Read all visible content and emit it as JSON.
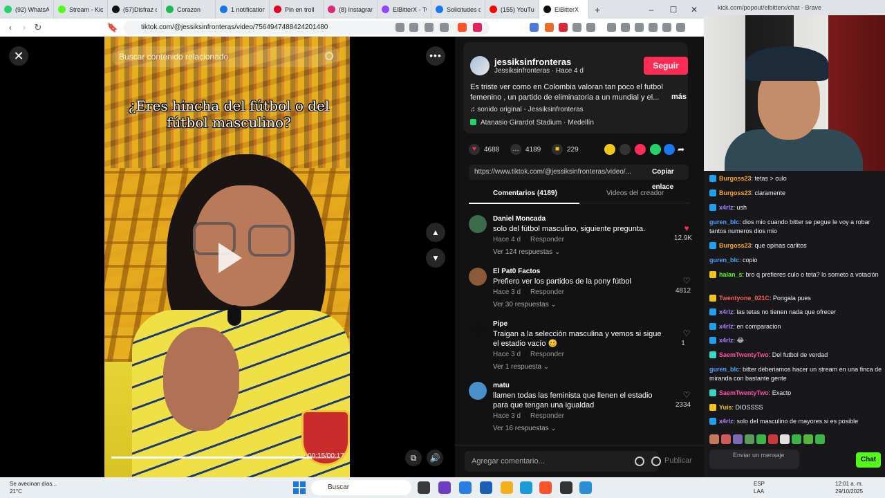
{
  "browser": {
    "tabs": [
      {
        "label": "(92) WhatsAp",
        "color": "#25d366"
      },
      {
        "label": "Stream - Kick",
        "color": "#53fc18"
      },
      {
        "label": "(57)Disfraz d",
        "color": "#111111"
      },
      {
        "label": "Corazon",
        "color": "#1db954"
      },
      {
        "label": "1 notification",
        "color": "#1a73e8"
      },
      {
        "label": "Pin en troll",
        "color": "#e60023"
      },
      {
        "label": "(8) Instagram",
        "color": "#d62976"
      },
      {
        "label": "ElBitterX - Tw",
        "color": "#9146ff"
      },
      {
        "label": "Solicitudes d",
        "color": "#1877f2"
      },
      {
        "label": "(155) YouTub",
        "color": "#ff0000"
      },
      {
        "label": "ElBitterX",
        "color": "#111111"
      }
    ],
    "url": "tiktok.com/@jessiksinfronteras/video/7564947488424201480"
  },
  "video": {
    "search_placeholder": "Buscar contenido relacionado",
    "caption": "¿Eres hincha del fútbol o del fútbol masculino?",
    "time": "00:15/00:17",
    "progress": 0.88
  },
  "post": {
    "author": "jessiksinfronteras",
    "author_sub": "Jessiksinfronteras · Hace 4 d",
    "follow_label": "Seguir",
    "description": "Es triste ver como en Colombia valoran tan poco el futbol femenino , un partido de eliminatoria a un mundial y el...",
    "more_label": "más",
    "sound": "sonido original - Jessiksinfronteras",
    "location": "Atanasio Girardot Stadium · Medellín",
    "likes": "4688",
    "comments": "4189",
    "saves": "229",
    "link": "https://www.tiktok.com/@jessiksinfronteras/video/...",
    "copy_label": "Copiar enlace",
    "tab_comments": "Comentarios (4189)",
    "tab_creator": "Videos del creador"
  },
  "comments": [
    {
      "name": "Daniel Moncada",
      "text": "solo del fútbol masculino, siguiente pregunta.",
      "time": "Hace 4 d",
      "reply": "Responder",
      "replies": "Ver 124 respuestas",
      "likes": "12.9K",
      "liked": true,
      "avatar": "#3a6b4a"
    },
    {
      "name": "El Pat0 Factos",
      "text": "Prefiero ver los partidos de la pony fútbol",
      "time": "Hace 3 d",
      "reply": "Responder",
      "replies": "Ver 30 respuestas",
      "likes": "4812",
      "liked": false,
      "avatar": "#8a5a3a"
    },
    {
      "name": "Pipe",
      "text": "Traigan a la selección masculina y vemos si sigue el estadio vacío 🥴",
      "time": "Hace 3 d",
      "reply": "Responder",
      "replies": "Ver 1 respuesta",
      "likes": "1",
      "liked": false,
      "avatar": "#111111"
    },
    {
      "name": "matu",
      "text": "llamen todas las feminista que llenen el estadio para que tengan una igualdad",
      "time": "Hace 3 d",
      "reply": "Responder",
      "replies": "Ver 16 respuestas",
      "likes": "2334",
      "liked": false,
      "avatar": "#4a90c8"
    }
  ],
  "comment_bar": {
    "placeholder": "Agregar comentario...",
    "publish": "Publicar"
  },
  "stream": {
    "title": "kick.com/popout/elbitterx/chat - Brave",
    "messages": [
      {
        "user": "Burgoss23",
        "text": ": tetas > culo",
        "color": "#f5a623",
        "badge": "#1da1f2"
      },
      {
        "user": "Burgoss23",
        "text": ": claramente",
        "color": "#f5a623",
        "badge": "#1da1f2"
      },
      {
        "user": "x4rlz",
        "text": ": ush",
        "color": "#b07cff",
        "badge": "#1da1f2"
      },
      {
        "user": "guren_blc",
        "text": ": dios mio cuando bitter se pegue le voy a robar tantos numeros dios mio",
        "color": "#4aa3ff",
        "badge": ""
      },
      {
        "user": "Burgoss23",
        "text": ": que opinas carlitos",
        "color": "#f5a623",
        "badge": "#1da1f2"
      },
      {
        "user": "guren_blc",
        "text": ": copio",
        "color": "#4aa3ff",
        "badge": ""
      },
      {
        "user": "halan_s",
        "text": ": bro q prefieres culo o teta? lo someto a votación",
        "color": "#53fc18",
        "badge": "#f5c518"
      },
      {
        "user": "Twentyone_021C",
        "text": ": Pongala pues",
        "color": "#ff5a5a",
        "badge": "#f5c518"
      },
      {
        "user": "x4rlz",
        "text": ": las tetas no tienen nada que ofrecer",
        "color": "#b07cff",
        "badge": "#1da1f2"
      },
      {
        "user": "x4rlz",
        "text": ": en comparacion",
        "color": "#b07cff",
        "badge": "#1da1f2"
      },
      {
        "user": "x4rlz",
        "text": ": 😂",
        "color": "#b07cff",
        "badge": "#1da1f2"
      },
      {
        "user": "SaemTwentyTwo",
        "text": ": Del futbol de verdad",
        "color": "#ff4fa3",
        "badge": "#36d6c4"
      },
      {
        "user": "guren_blc",
        "text": ": bitter deberiamos hacer un stream en una finca de miranda con bastante gente",
        "color": "#4aa3ff",
        "badge": ""
      },
      {
        "user": "SaemTwentyTwo",
        "text": ": Exacto",
        "color": "#ff4fa3",
        "badge": "#36d6c4"
      },
      {
        "user": "Yuis",
        "text": ": DIOSSSS",
        "color": "#f5c518",
        "badge": "#f5c518"
      },
      {
        "user": "x4rlz",
        "text": ": solo del masculino de mayores si es posible",
        "color": "#b07cff",
        "badge": "#1da1f2"
      }
    ],
    "input_placeholder": "Enviar un mensaje",
    "chat_button": "Chat"
  },
  "taskbar": {
    "weather_title": "Se avecinan días...",
    "weather_temp": "21°C",
    "search": "Buscar",
    "lang1": "ESP",
    "lang2": "LAA",
    "time": "12:01 a. m.",
    "date": "29/10/2025"
  }
}
